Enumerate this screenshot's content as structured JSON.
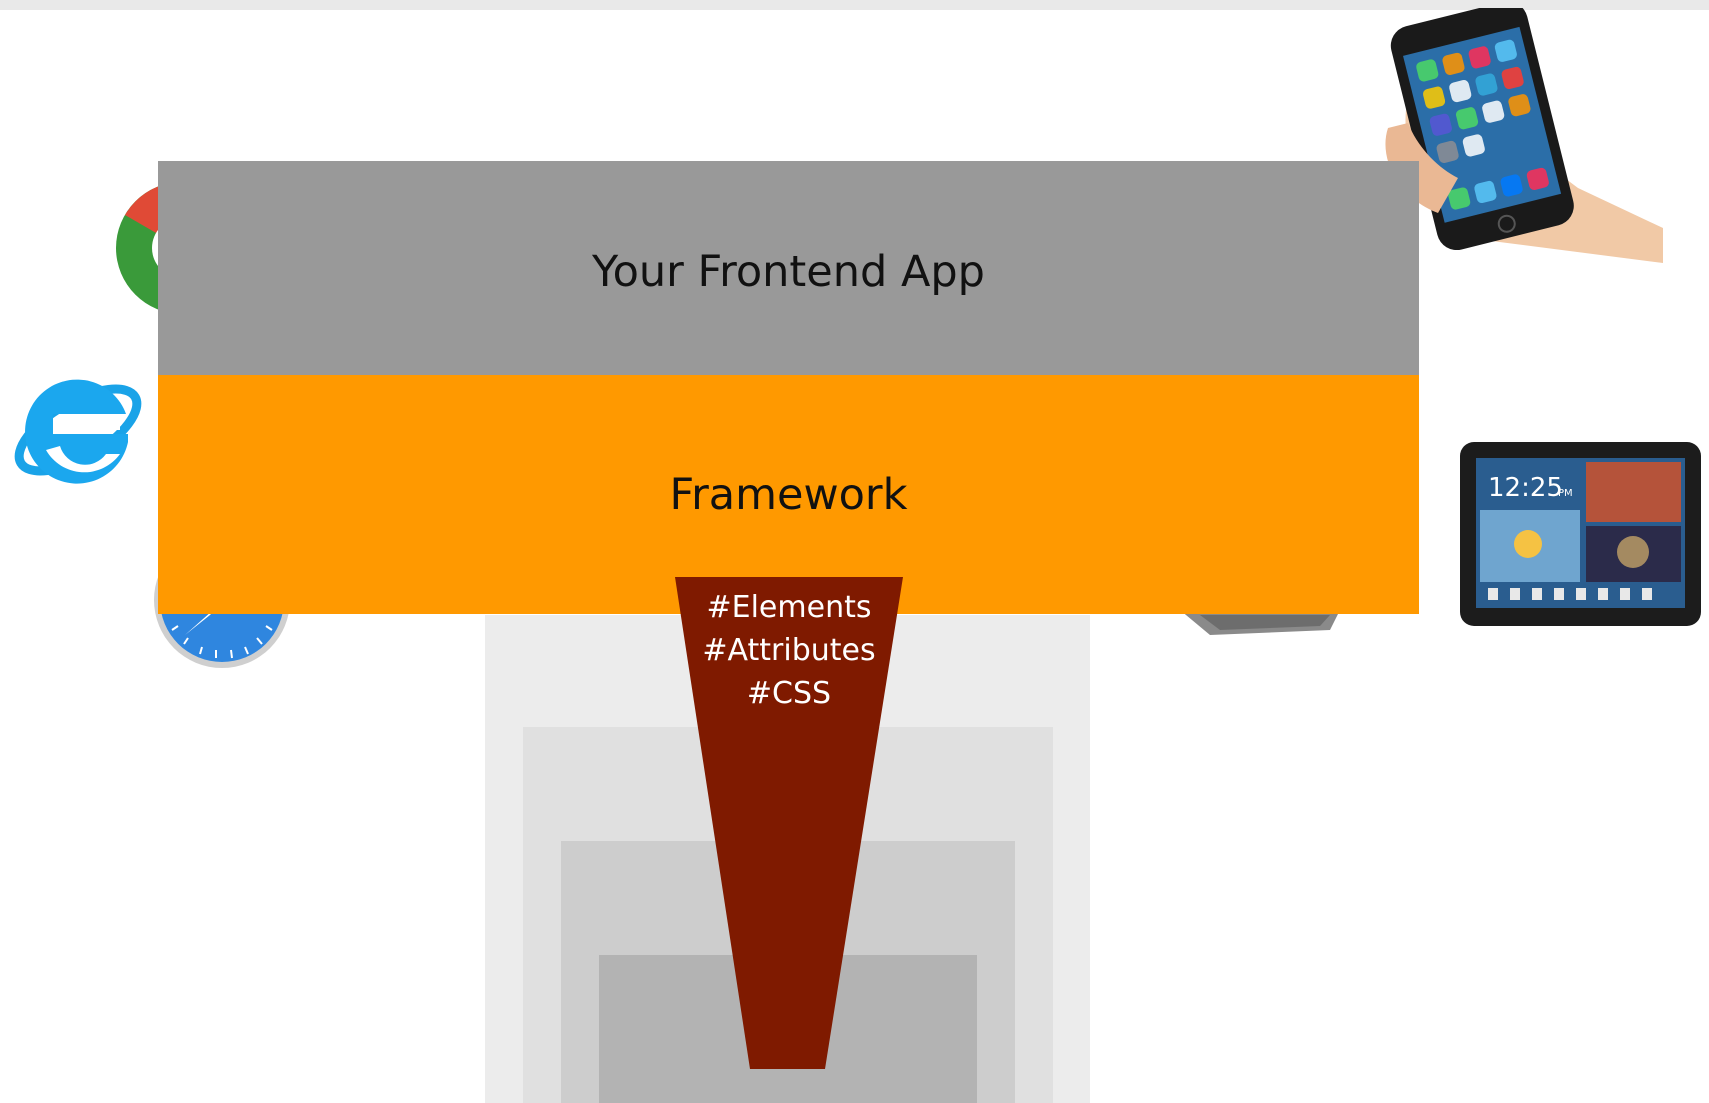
{
  "diagram": {
    "app_layer": {
      "label": "Your Frontend App"
    },
    "framework_layer": {
      "label": "Framework"
    },
    "funnel": {
      "lines": [
        "#Elements",
        "#Attributes",
        "#CSS"
      ]
    },
    "colors": {
      "app": "#999999",
      "framework": "#ff9900",
      "funnel": "#7f1a00"
    },
    "icons": [
      "chrome-icon",
      "internet-explorer-icon",
      "safari-icon",
      "smartphone-icon",
      "tablet-icon",
      "laptop-icon"
    ]
  }
}
